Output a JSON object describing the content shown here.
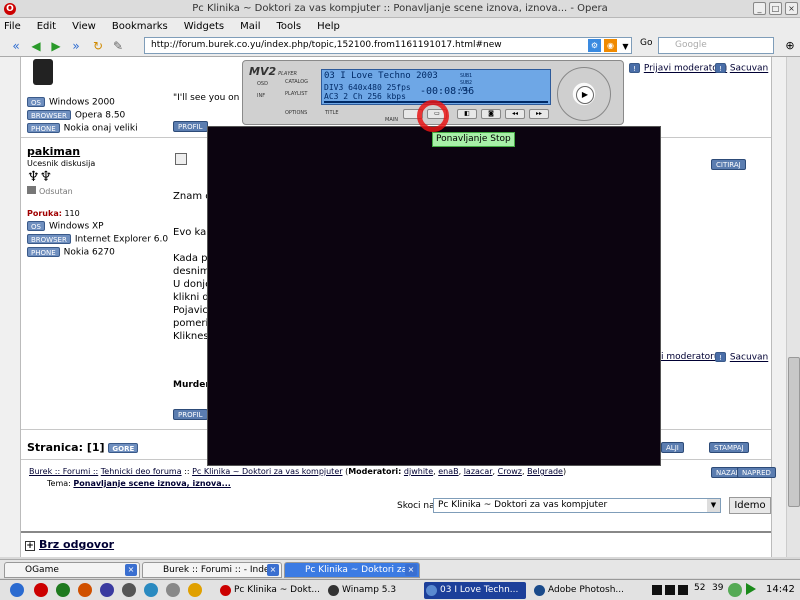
{
  "window": {
    "title": "Pc Klinika ~ Doktori za vas kompjuter :: Ponavljanje scene iznova, iznova... - Opera"
  },
  "menu": [
    "File",
    "Edit",
    "View",
    "Bookmarks",
    "Widgets",
    "Mail",
    "Tools",
    "Help"
  ],
  "address": {
    "url": "http://forum.burek.co.yu/index.php/topic,152100.from1161191017.html#new",
    "go_label": "Go",
    "search_placeholder": "Google"
  },
  "post1": {
    "quote": "\"I'll see you on the b",
    "os": "Windows 2000",
    "browser": "Opera 8.50",
    "phone": "Nokia onaj veliki",
    "profile_btn": "PROFIL"
  },
  "post2": {
    "username": "pakiman",
    "rank": "Ucesnik diskusija",
    "status": "Odsutan",
    "posts_label": "Poruka:",
    "posts_count": "110",
    "os": "Windows XP",
    "browser": "Internet Explorer 6.0",
    "phone": "Nokia 6270",
    "profile_btn": "PROFIL",
    "text_lines": [
      "Znam c",
      "Evo kak",
      "Kada pu",
      "desnim",
      "U donje",
      "klikni d",
      "Pojavic",
      "pomeri",
      "Kliknes"
    ],
    "signature": "Murder :"
  },
  "badges": {
    "os": "OS",
    "browser": "BROWSER",
    "phone": "PHONE"
  },
  "header_links": {
    "moderator": "Prijavi moderatoru",
    "save": "Sacuvan",
    "moderator2": "i moderatoru",
    "save2": "Sacuvan",
    "quote_btn": "CITIRAJ"
  },
  "pagination": {
    "label": "Stranica:",
    "current": "[1]",
    "more": "GORE",
    "print_btn": "STAMPAJ",
    "other_btn": "ALJI"
  },
  "breadcrumb": {
    "root": "Burek :: Forumi ::",
    "section": "Tehnicki deo foruma",
    "forum": "Pc Klinika ~ Doktori za vas kompjuter",
    "moderators_label": "Moderatori:",
    "moderators": [
      "djwhite",
      "enaB",
      "lazacar",
      "Crowz",
      "Belgrade"
    ],
    "topic_label": "Tema:",
    "topic": "Ponavljanje scene iznova, iznova...",
    "nav_prev": "NAZAD",
    "nav_next": "NAPRED"
  },
  "jump": {
    "label": "Skoci na:",
    "selected": "Pc Klinika ~ Doktori za vas kompjuter",
    "button": "Idemo"
  },
  "quick_reply": {
    "title": "Brz odgovor"
  },
  "player": {
    "logo": "MV2",
    "logo_sub": "PLAYER",
    "track": "03 I Love Techno 2003",
    "codec1": "DIV3",
    "res": "640x480",
    "fps": "25fps",
    "codec2": "AC3",
    "channels": "2 Ch",
    "bitrate": "256 kbps",
    "sub1": "SUB1",
    "sub2": "SUB2",
    "vol": "VOL",
    "time": "-00:08:36",
    "labels": {
      "osd": "OSD",
      "info": "INF",
      "catalog": "CATALOG",
      "playlist": "PLAYLIST",
      "options": "OPTIONS",
      "title": "TITLE",
      "main": "MAIN"
    }
  },
  "tooltip": "Ponavljanje Stop",
  "tabs": [
    {
      "label": "OGame"
    },
    {
      "label": "Burek :: Forumi :: - Index"
    },
    {
      "label": "Pc Klinika ~ Doktori za v..."
    }
  ],
  "taskbar": {
    "items": [
      "Pc Klinika ~ Dokt...",
      "Winamp 5.3",
      "03 I Love Techn...",
      "Adobe Photosh..."
    ],
    "tray_numbers": [
      "52",
      "39"
    ],
    "clock": "14:42"
  }
}
